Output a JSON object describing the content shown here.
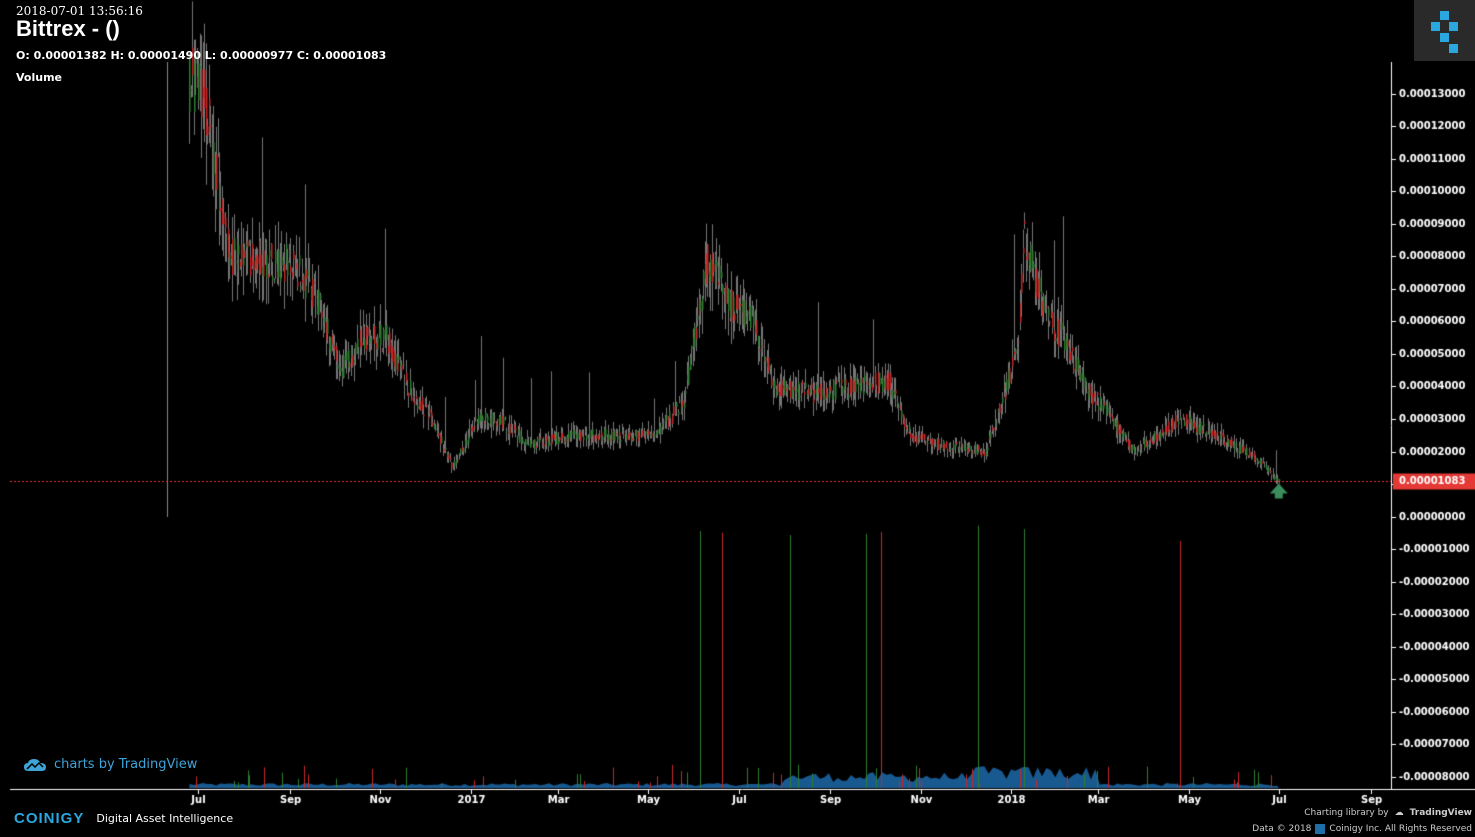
{
  "header": {
    "timestamp": "2018-07-01 13:56:16",
    "title": "Bittrex -  ()",
    "ohlc": "O: 0.00001382 H: 0.00001490 L: 0.00000977 C: 0.00001083",
    "volume_label": "Volume"
  },
  "branding": {
    "tradingview_link": "charts by TradingView",
    "coinigy_brand": "COINIGY",
    "coinigy_tagline": "Digital Asset Intelligence",
    "charting_library": "Charting library by",
    "tradingview_name": "TradingView",
    "data_prefix": "Data © 2018",
    "data_suffix": "Coinigy Inc. All Rights Reserved"
  },
  "colors": {
    "background": "#000000",
    "up": "#2e7d32",
    "down": "#c62828",
    "last_price": "#e53935",
    "volume_area": "#1e6fb4",
    "arrow": "#3a8c5c"
  },
  "chart_data": {
    "type": "candlestick",
    "last_price_label": "0.00001083",
    "x_ticks": [
      "Jul",
      "Sep",
      "Nov",
      "2017",
      "Mar",
      "May",
      "Jul",
      "Sep",
      "Nov",
      "2018",
      "Mar",
      "May",
      "Jul",
      "Sep"
    ],
    "y_ticks": [
      "0.00013000",
      "0.00012000",
      "0.00011000",
      "0.00010000",
      "0.00009000",
      "0.00008000",
      "0.00007000",
      "0.00006000",
      "0.00005000",
      "0.00004000",
      "0.00003000",
      "0.00002000",
      "0.00001000",
      "0.00000000",
      "-0.00001000",
      "-0.00002000",
      "-0.00003000",
      "-0.00004000",
      "-0.00005000",
      "-0.00006000",
      "-0.00007000",
      "-0.00008000"
    ],
    "ylim": [
      -8.38e-05,
      0.0001398
    ],
    "last_price": 1.083e-05,
    "x_range_months": [
      "2016-05",
      "2018-10"
    ],
    "price_trend": [
      [
        "2016-06-25",
        0.000135
      ],
      [
        "2016-07-05",
        0.00013
      ],
      [
        "2016-07-15",
        0.0001
      ],
      [
        "2016-07-22",
        8e-05
      ],
      [
        "2016-08-10",
        8e-05
      ],
      [
        "2016-09-05",
        7.7e-05
      ],
      [
        "2016-09-20",
        6.5e-05
      ],
      [
        "2016-10-05",
        4.5e-05
      ],
      [
        "2016-10-20",
        5.5e-05
      ],
      [
        "2016-11-05",
        5.5e-05
      ],
      [
        "2016-11-20",
        4e-05
      ],
      [
        "2016-12-05",
        3e-05
      ],
      [
        "2016-12-20",
        1.5e-05
      ],
      [
        "2017-01-05",
        3e-05
      ],
      [
        "2017-01-20",
        3e-05
      ],
      [
        "2017-02-10",
        2.2e-05
      ],
      [
        "2017-03-10",
        2.5e-05
      ],
      [
        "2017-04-05",
        2.5e-05
      ],
      [
        "2017-05-05",
        2.5e-05
      ],
      [
        "2017-05-25",
        3.5e-05
      ],
      [
        "2017-06-10",
        8e-05
      ],
      [
        "2017-06-25",
        6.5e-05
      ],
      [
        "2017-07-10",
        6e-05
      ],
      [
        "2017-07-25",
        4e-05
      ],
      [
        "2017-08-20",
        3.8e-05
      ],
      [
        "2017-09-20",
        4e-05
      ],
      [
        "2017-10-10",
        4.2e-05
      ],
      [
        "2017-10-25",
        2.5e-05
      ],
      [
        "2017-11-15",
        2.2e-05
      ],
      [
        "2017-12-15",
        2e-05
      ],
      [
        "2017-12-25",
        3.5e-05
      ],
      [
        "2018-01-05",
        5e-05
      ],
      [
        "2018-01-10",
        8.5e-05
      ],
      [
        "2018-01-25",
        6e-05
      ],
      [
        "2018-02-05",
        5.5e-05
      ],
      [
        "2018-02-20",
        4e-05
      ],
      [
        "2018-03-10",
        3e-05
      ],
      [
        "2018-03-25",
        2e-05
      ],
      [
        "2018-04-10",
        2.5e-05
      ],
      [
        "2018-04-25",
        3e-05
      ],
      [
        "2018-05-20",
        2.5e-05
      ],
      [
        "2018-06-15",
        1.8e-05
      ],
      [
        "2018-07-01",
        1.08e-05
      ]
    ],
    "volume_spikes": [
      [
        "2017-06-05",
        -4.5e-06
      ],
      [
        "2017-06-20",
        -5e-06
      ],
      [
        "2017-08-05",
        -5.7e-06
      ],
      [
        "2017-09-25",
        -5.3e-06
      ],
      [
        "2017-10-05",
        -4.7e-06
      ],
      [
        "2017-12-10",
        -2.8e-06
      ],
      [
        "2018-01-10",
        -3.8e-06
      ],
      [
        "2018-04-25",
        -7.5e-06
      ]
    ]
  }
}
